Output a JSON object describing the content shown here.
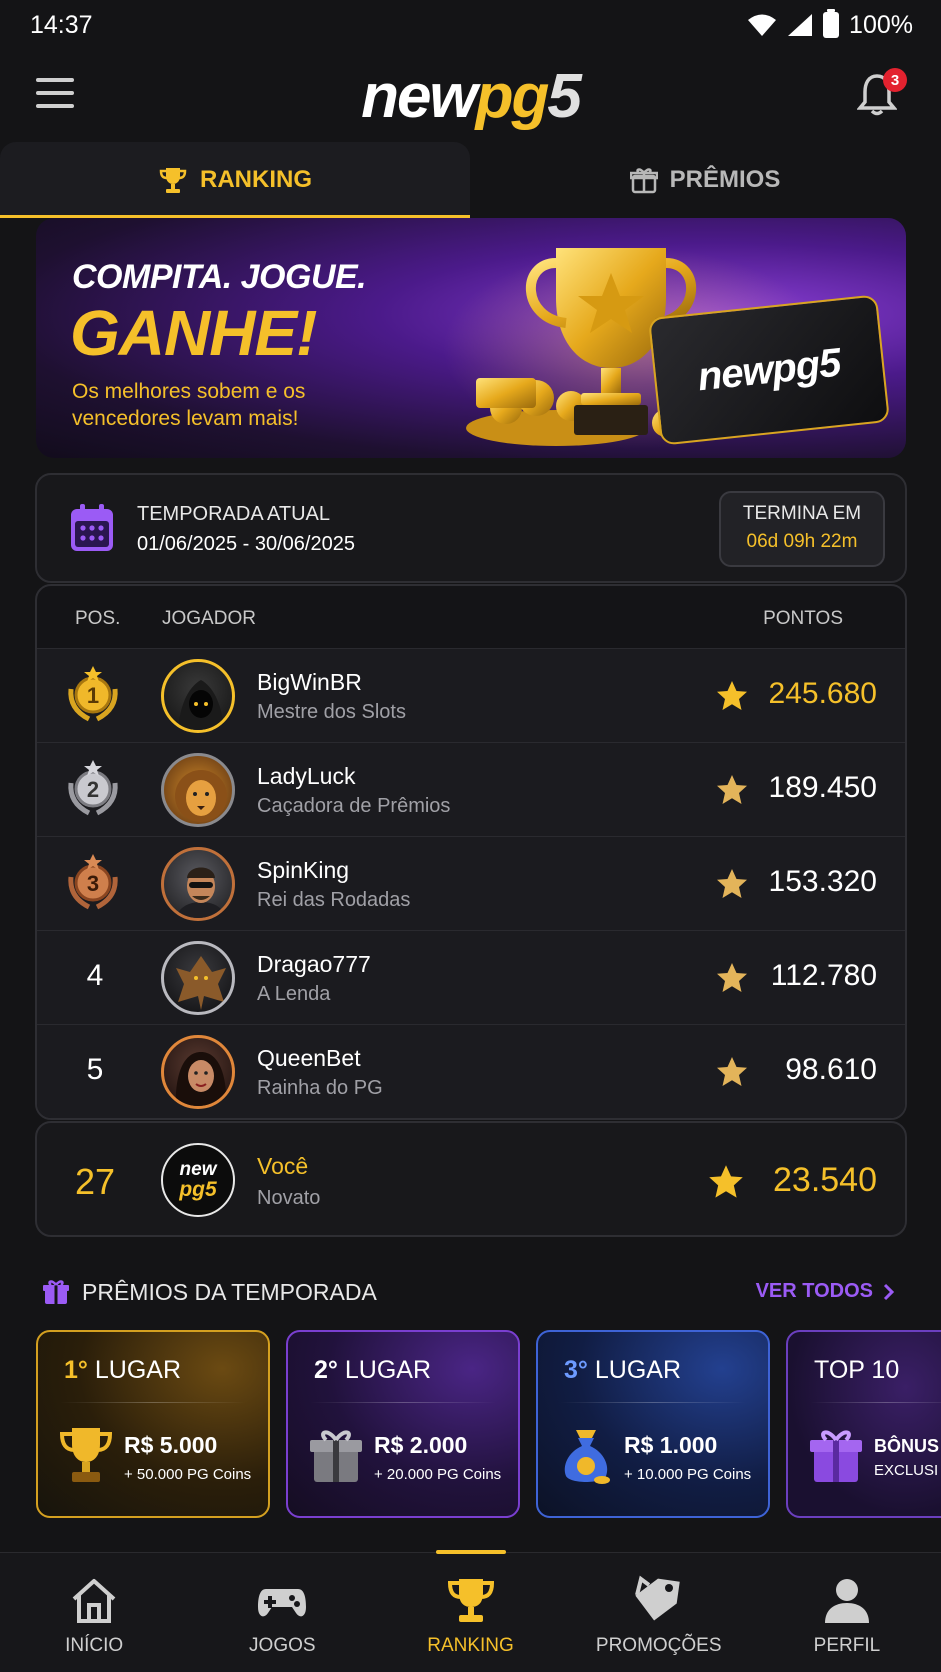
{
  "status_bar": {
    "time": "14:37",
    "battery": "100%"
  },
  "header": {
    "logo_new": "new",
    "logo_pg": "pg",
    "logo_five": "5",
    "notification_count": "3"
  },
  "tabs": [
    {
      "label": "RANKING",
      "active": true,
      "icon": "trophy-icon"
    },
    {
      "label": "PRÊMIOS",
      "active": false,
      "icon": "gift-icon"
    }
  ],
  "banner": {
    "title_line1": "COMPITA. JOGUE.",
    "title_line2": "GANHE!",
    "subtitle": "Os melhores sobem e os vencedores levam mais!",
    "card_logo": "newpg5"
  },
  "season": {
    "label": "TEMPORADA ATUAL",
    "dates": "01/06/2025 - 30/06/2025",
    "ends_label": "TERMINA EM",
    "ends_time": "06d 09h 22m"
  },
  "ranking": {
    "headers": {
      "position": "POS.",
      "player": "JOGADOR",
      "points": "PONTOS"
    },
    "rows": [
      {
        "position": "1",
        "name": "BigWinBR",
        "title": "Mestre dos Slots",
        "points": "245.680",
        "medal": "gold"
      },
      {
        "position": "2",
        "name": "LadyLuck",
        "title": "Caçadora de Prêmios",
        "points": "189.450",
        "medal": "silver"
      },
      {
        "position": "3",
        "name": "SpinKing",
        "title": "Rei das Rodadas",
        "points": "153.320",
        "medal": "bronze"
      },
      {
        "position": "4",
        "name": "Dragao777",
        "title": "A Lenda",
        "points": "112.780",
        "medal": "none"
      },
      {
        "position": "5",
        "name": "QueenBet",
        "title": "Rainha do PG",
        "points": "98.610",
        "medal": "none"
      }
    ]
  },
  "you": {
    "position": "27",
    "name": "Você",
    "title": "Novato",
    "points": "23.540",
    "avatar_line1": "new",
    "avatar_line2": "pg5"
  },
  "prizes": {
    "section_title": "PRÊMIOS DA TEMPORADA",
    "see_all": "VER TODOS",
    "items": [
      {
        "ordinal": "1°",
        "label": "LUGAR",
        "amount": "R$ 5.000",
        "coins": "+ 50.000 PG Coins",
        "icon": "trophy-icon"
      },
      {
        "ordinal": "2°",
        "label": "LUGAR",
        "amount": "R$ 2.000",
        "coins": "+ 20.000 PG Coins",
        "icon": "gift-box-icon"
      },
      {
        "ordinal": "3°",
        "label": "LUGAR",
        "amount": "R$ 1.000",
        "coins": "+ 10.000 PG Coins",
        "icon": "money-bag-icon"
      },
      {
        "ordinal": "",
        "label": "TOP 10",
        "amount": "BÔNUS",
        "coins": "EXCLUSI",
        "icon": "gift-icon"
      }
    ]
  },
  "bottom_nav": [
    {
      "label": "INÍCIO",
      "icon": "home-icon",
      "active": false
    },
    {
      "label": "JOGOS",
      "icon": "gamepad-icon",
      "active": false
    },
    {
      "label": "RANKING",
      "icon": "trophy-icon",
      "active": true
    },
    {
      "label": "PROMOÇÕES",
      "icon": "tag-icon",
      "active": false
    },
    {
      "label": "PERFIL",
      "icon": "user-icon",
      "active": false
    }
  ],
  "colors": {
    "accent": "#f5c02a",
    "purple": "#9b5bf5",
    "background": "#141416"
  }
}
